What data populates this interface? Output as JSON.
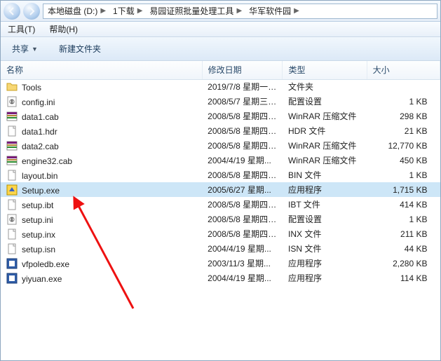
{
  "breadcrumbs": [
    "本地磁盘 (D:)",
    "1下载",
    "易园证照批量处理工具",
    "华军软件园"
  ],
  "menubar": [
    {
      "label": "工具(T)"
    },
    {
      "label": "帮助(H)"
    }
  ],
  "toolbar": {
    "share": "共享",
    "newfolder": "新建文件夹"
  },
  "columns": {
    "name": "名称",
    "date": "修改日期",
    "type": "类型",
    "size": "大小"
  },
  "files": [
    {
      "icon": "folder",
      "name": "Tools",
      "date": "2019/7/8 星期一 ...",
      "type": "文件夹",
      "size": "",
      "sel": false
    },
    {
      "icon": "ini",
      "name": "config.ini",
      "date": "2008/5/7 星期三 ...",
      "type": "配置设置",
      "size": "1 KB",
      "sel": false
    },
    {
      "icon": "rar",
      "name": "data1.cab",
      "date": "2008/5/8 星期四 ...",
      "type": "WinRAR 压缩文件",
      "size": "298 KB",
      "sel": false
    },
    {
      "icon": "file",
      "name": "data1.hdr",
      "date": "2008/5/8 星期四 ...",
      "type": "HDR 文件",
      "size": "21 KB",
      "sel": false
    },
    {
      "icon": "rar",
      "name": "data2.cab",
      "date": "2008/5/8 星期四 ...",
      "type": "WinRAR 压缩文件",
      "size": "12,770 KB",
      "sel": false
    },
    {
      "icon": "rar",
      "name": "engine32.cab",
      "date": "2004/4/19 星期...",
      "type": "WinRAR 压缩文件",
      "size": "450 KB",
      "sel": false
    },
    {
      "icon": "file",
      "name": "layout.bin",
      "date": "2008/5/8 星期四 ...",
      "type": "BIN 文件",
      "size": "1 KB",
      "sel": false
    },
    {
      "icon": "exe-y",
      "name": "Setup.exe",
      "date": "2005/6/27 星期...",
      "type": "应用程序",
      "size": "1,715 KB",
      "sel": true
    },
    {
      "icon": "file",
      "name": "setup.ibt",
      "date": "2008/5/8 星期四 ...",
      "type": "IBT 文件",
      "size": "414 KB",
      "sel": false
    },
    {
      "icon": "ini",
      "name": "setup.ini",
      "date": "2008/5/8 星期四 ...",
      "type": "配置设置",
      "size": "1 KB",
      "sel": false
    },
    {
      "icon": "file",
      "name": "setup.inx",
      "date": "2008/5/8 星期四 ...",
      "type": "INX 文件",
      "size": "211 KB",
      "sel": false
    },
    {
      "icon": "file",
      "name": "setup.isn",
      "date": "2004/4/19 星期...",
      "type": "ISN 文件",
      "size": "44 KB",
      "sel": false
    },
    {
      "icon": "exe-b",
      "name": "vfpoledb.exe",
      "date": "2003/11/3 星期...",
      "type": "应用程序",
      "size": "2,280 KB",
      "sel": false
    },
    {
      "icon": "exe-b",
      "name": "yiyuan.exe",
      "date": "2004/4/19 星期...",
      "type": "应用程序",
      "size": "114 KB",
      "sel": false
    }
  ],
  "annotation": {
    "arrow_color": "#e11",
    "target_row_index": 7
  }
}
